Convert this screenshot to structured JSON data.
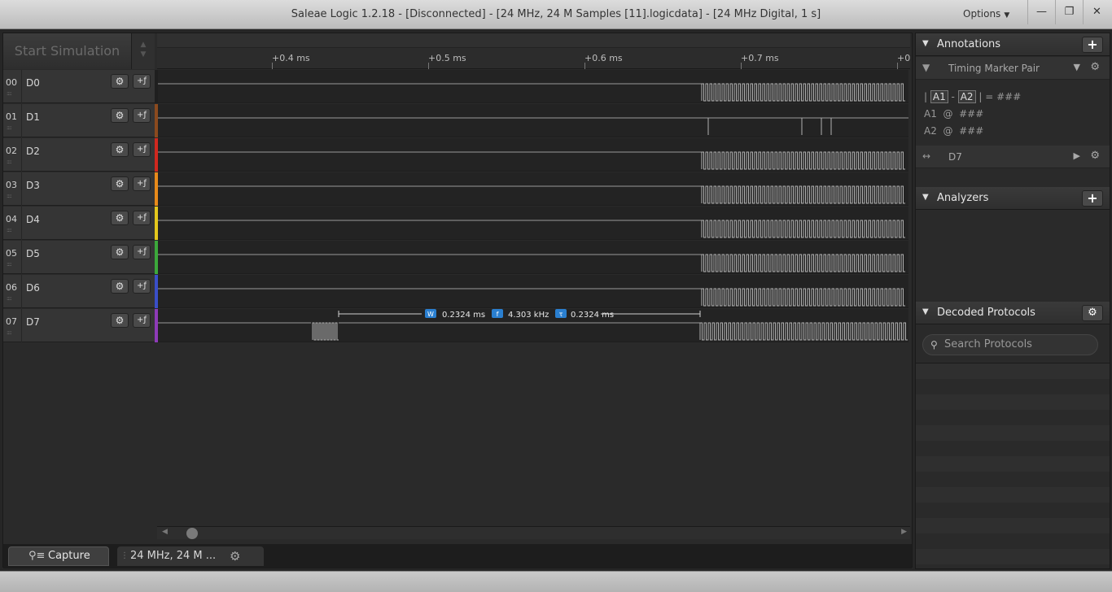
{
  "window": {
    "title": "Saleae Logic 1.2.18 - [Disconnected] - [24 MHz, 24 M Samples [11].logicdata] - [24 MHz Digital, 1 s]",
    "options_label": "Options",
    "minimize_glyph": "—",
    "restore_glyph": "❐",
    "close_glyph": "✕"
  },
  "toolbar": {
    "start_simulation": "Start Simulation"
  },
  "ruler": {
    "ticks": [
      "+0.4 ms",
      "+0.5 ms",
      "+0.6 ms",
      "+0.7 ms",
      "+0"
    ]
  },
  "channels": [
    {
      "num": "00",
      "name": "D0",
      "color": "#1f1f1f"
    },
    {
      "num": "01",
      "name": "D1",
      "color": "#8b4a1e"
    },
    {
      "num": "02",
      "name": "D2",
      "color": "#d0281f"
    },
    {
      "num": "03",
      "name": "D3",
      "color": "#e88a1a"
    },
    {
      "num": "04",
      "name": "D4",
      "color": "#e4c71c"
    },
    {
      "num": "05",
      "name": "D5",
      "color": "#3ca83b"
    },
    {
      "num": "06",
      "name": "D6",
      "color": "#3a4fc8"
    },
    {
      "num": "07",
      "name": "D7",
      "color": "#8e3bb8"
    }
  ],
  "measurement": {
    "w_icon": "W",
    "width": "0.2324 ms",
    "f_icon": "f",
    "frequency": "4.303 kHz",
    "t_icon": "τ",
    "period": "0.2324 ms"
  },
  "tabs": {
    "capture": "Capture",
    "data": "24 MHz, 24 M ..."
  },
  "annotations": {
    "title": "Annotations",
    "marker_pair": "Timing Marker Pair",
    "a1": "A1",
    "a2": "A2",
    "dash": "-",
    "equals": "= ###",
    "at": "@",
    "hash": "###",
    "measurement_channel": "D7"
  },
  "analyzers": {
    "title": "Analyzers"
  },
  "decoded": {
    "title": "Decoded Protocols",
    "search_placeholder": "Search Protocols"
  },
  "icons": {
    "gear": "gear-icon",
    "trigger": "trigger-icon",
    "plus": "plus-icon",
    "triangle": "collapse-triangle-icon",
    "search": "search-icon",
    "capture": "capture-icon"
  }
}
